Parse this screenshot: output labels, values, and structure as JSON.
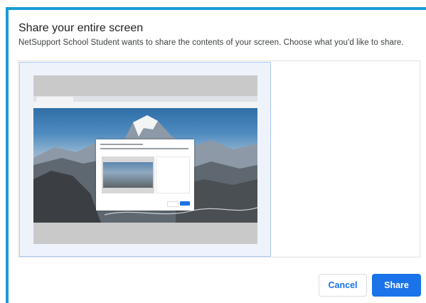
{
  "dialog": {
    "title": "Share your entire screen",
    "description": "NetSupport School Student wants to share the contents of your screen. Choose what you'd like to share."
  },
  "sources": [
    {
      "type": "entire-screen",
      "selected": true
    }
  ],
  "footer": {
    "cancel_label": "Cancel",
    "share_label": "Share"
  },
  "colors": {
    "accent": "#1a9bd7",
    "primary_button": "#1a73e8",
    "selected_border": "#a8c7fa",
    "selected_bg": "#eef3fb"
  }
}
